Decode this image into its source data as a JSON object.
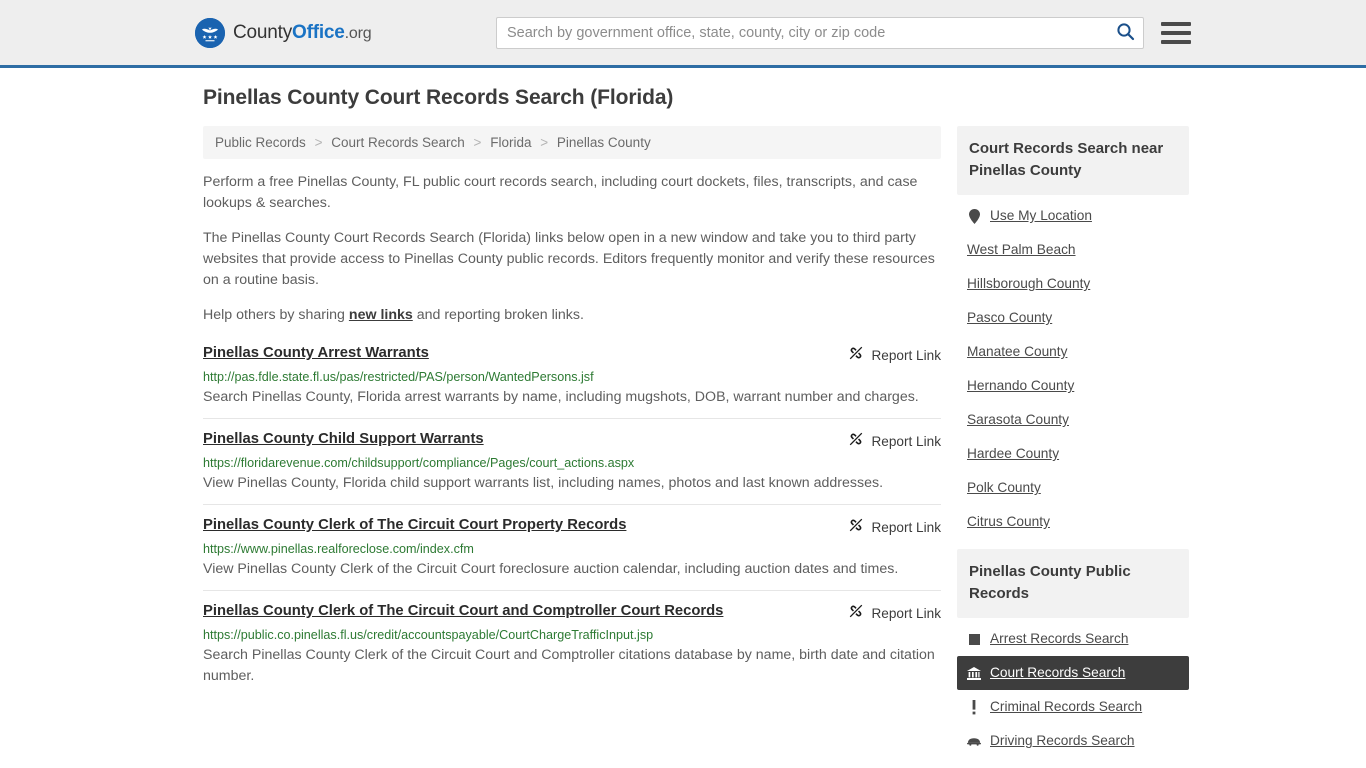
{
  "header": {
    "brand": {
      "part1": "County",
      "part2": "Office",
      "part3": ".org",
      "logo_icon": "eagle-shield-logo"
    },
    "search": {
      "placeholder": "Search by government office, state, county, city or zip code",
      "value": "",
      "icon": "search-icon"
    },
    "menu": {
      "icon": "hamburger-menu-icon"
    }
  },
  "main": {
    "title": "Pinellas County Court Records Search (Florida)",
    "breadcrumb": [
      {
        "label": "Public Records"
      },
      {
        "label": "Court Records Search"
      },
      {
        "label": "Florida"
      },
      {
        "label": "Pinellas County"
      }
    ],
    "breadcrumb_separator": ">",
    "intro": [
      "Perform a free Pinellas County, FL public court records search, including court dockets, files, transcripts, and case lookups & searches.",
      "The Pinellas County Court Records Search (Florida) links below open in a new window and take you to third party websites that provide access to Pinellas County public records. Editors frequently monitor and verify these resources on a routine basis."
    ],
    "help_line": {
      "before": "Help others by sharing ",
      "link": "new links",
      "after": " and reporting broken links."
    },
    "report_link_label": "Report Link",
    "report_link_icon": "broken-link-icon",
    "results": [
      {
        "title": "Pinellas County Arrest Warrants",
        "url": "http://pas.fdle.state.fl.us/pas/restricted/PAS/person/WantedPersons.jsf",
        "description": "Search Pinellas County, Florida arrest warrants by name, including mugshots, DOB, warrant number and charges."
      },
      {
        "title": "Pinellas County Child Support Warrants",
        "url": "https://floridarevenue.com/childsupport/compliance/Pages/court_actions.aspx",
        "description": "View Pinellas County, Florida child support warrants list, including names, photos and last known addresses."
      },
      {
        "title": "Pinellas County Clerk of The Circuit Court Property Records",
        "url": "https://www.pinellas.realforeclose.com/index.cfm",
        "description": "View Pinellas County Clerk of the Circuit Court foreclosure auction calendar, including auction dates and times."
      },
      {
        "title": "Pinellas County Clerk of The Circuit Court and Comptroller Court Records",
        "url": "https://public.co.pinellas.fl.us/credit/accountspayable/CourtChargeTrafficInput.jsp",
        "description": "Search Pinellas County Clerk of the Circuit Court and Comptroller citations database by name, birth date and citation number."
      }
    ]
  },
  "sidebar": {
    "nearby": {
      "heading": "Court Records Search near Pinellas County",
      "items": [
        {
          "label": "Use My Location",
          "icon": "map-pin-icon"
        },
        {
          "label": "West Palm Beach",
          "icon": ""
        },
        {
          "label": "Hillsborough County",
          "icon": ""
        },
        {
          "label": "Pasco County",
          "icon": ""
        },
        {
          "label": "Manatee County",
          "icon": ""
        },
        {
          "label": "Hernando County",
          "icon": ""
        },
        {
          "label": "Sarasota County",
          "icon": ""
        },
        {
          "label": "Hardee County",
          "icon": ""
        },
        {
          "label": "Polk County",
          "icon": ""
        },
        {
          "label": "Citrus County",
          "icon": ""
        }
      ]
    },
    "public_records": {
      "heading": "Pinellas County Public Records",
      "items": [
        {
          "label": "Arrest Records Search",
          "icon": "square-icon",
          "active": false
        },
        {
          "label": "Court Records Search",
          "icon": "courthouse-icon",
          "active": true
        },
        {
          "label": "Criminal Records Search",
          "icon": "exclamation-icon",
          "active": false
        },
        {
          "label": "Driving Records Search",
          "icon": "car-icon",
          "active": false
        }
      ]
    }
  },
  "colors": {
    "accent_blue": "#2e6da4",
    "brand_blue": "#1a73c4",
    "header_bg": "#eeeeee",
    "url_green": "#2d7a33",
    "active_bg": "#3d3d3d"
  }
}
